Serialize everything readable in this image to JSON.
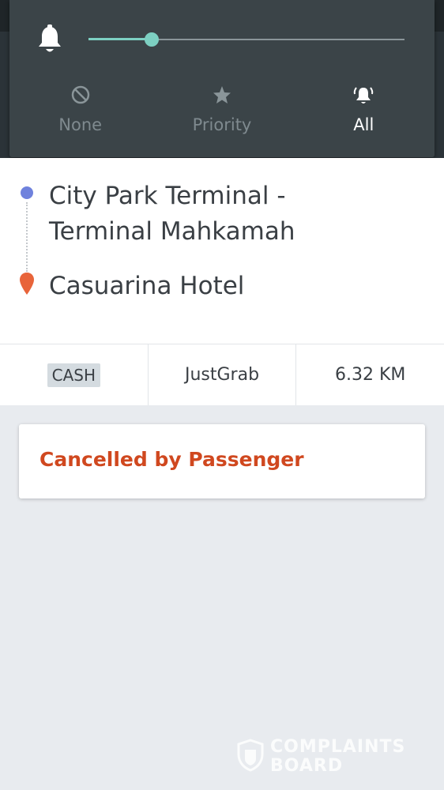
{
  "notification_panel": {
    "volume_level_percent": 20,
    "modes": [
      {
        "label": "None",
        "icon": "block-icon",
        "active": false
      },
      {
        "label": "Priority",
        "icon": "star-icon",
        "active": false
      },
      {
        "label": "All",
        "icon": "bell-ringing-icon",
        "active": true
      }
    ]
  },
  "trip": {
    "pickup": "City Park Terminal - Terminal Mahkamah",
    "dropoff": "Casuarina Hotel",
    "payment": "CASH",
    "service": "JustGrab",
    "distance": "6.32 KM",
    "status": "Cancelled by Passenger"
  },
  "colors": {
    "accent_teal": "#7dd0c2",
    "pickup_dot": "#6f82dd",
    "dropoff_pin": "#e8643a",
    "status_red": "#d0481f"
  },
  "watermark": {
    "line1": "COMPLAINTS",
    "line2": "BOARD"
  }
}
